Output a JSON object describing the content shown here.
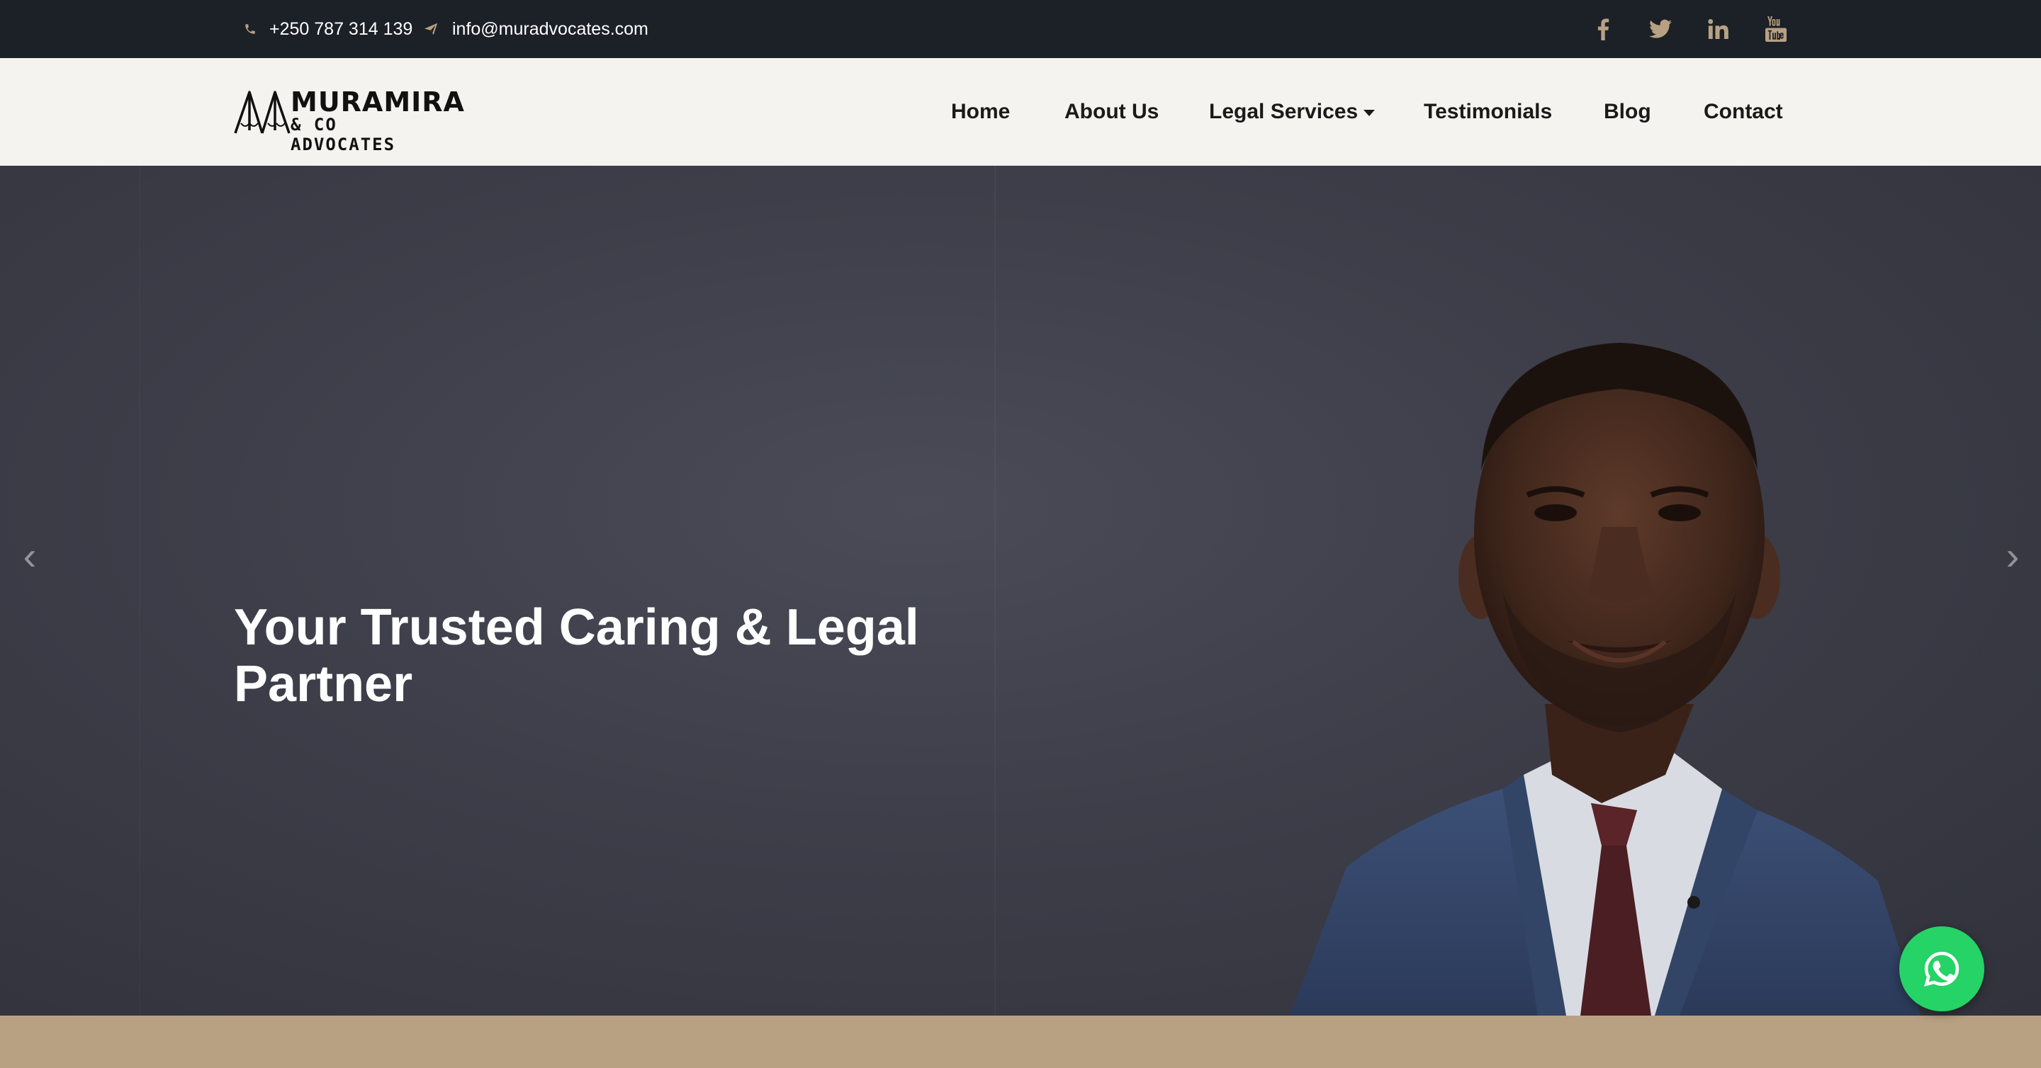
{
  "topbar": {
    "phone": "+250 787 314 139",
    "email": "info@muradvocates.com",
    "social": [
      {
        "icon": "facebook-icon"
      },
      {
        "icon": "twitter-icon"
      },
      {
        "icon": "linkedin-icon"
      },
      {
        "icon": "youtube-icon"
      }
    ]
  },
  "logo": {
    "name": "MURAMIRA",
    "sub": "& CO ADVOCATES"
  },
  "nav": {
    "home": "Home",
    "about": "About Us",
    "legal": "Legal Services",
    "testimonials": "Testimonials",
    "blog": "Blog",
    "contact": "Contact"
  },
  "hero": {
    "title": "Your Trusted Caring & Legal Partner",
    "prev": "‹",
    "next": "›"
  },
  "colors": {
    "topbar": "#1c2027",
    "navbar": "#f4f3ef",
    "accent_gold": "#b8a183",
    "whatsapp": "#25d366"
  }
}
